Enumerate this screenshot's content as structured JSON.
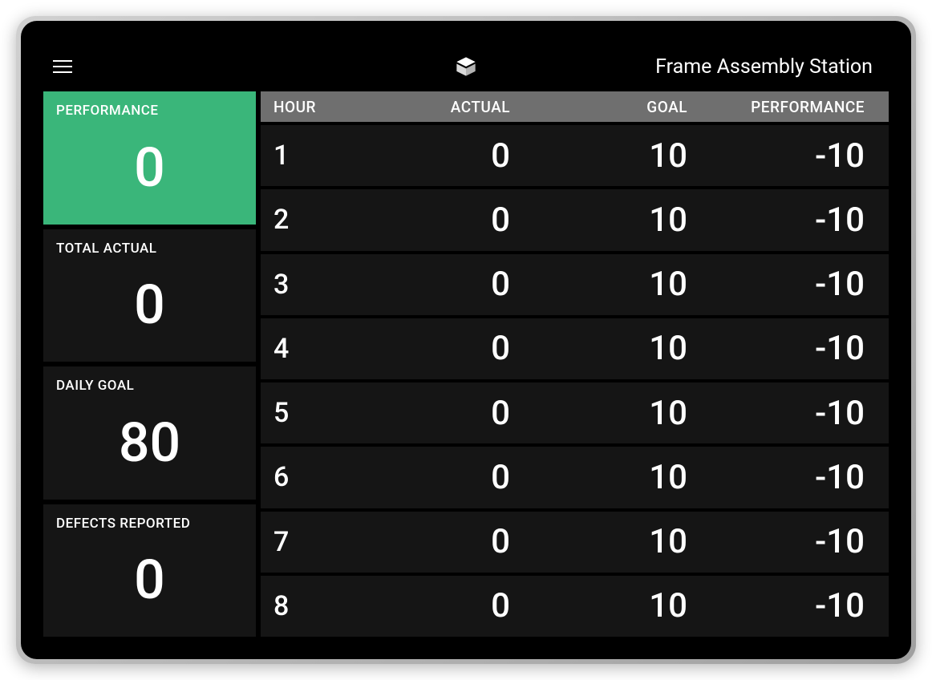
{
  "header": {
    "station_title": "Frame Assembly Station"
  },
  "sidebar": {
    "performance": {
      "label": "PERFORMANCE",
      "value": "0"
    },
    "total_actual": {
      "label": "TOTAL ACTUAL",
      "value": "0"
    },
    "daily_goal": {
      "label": "DAILY GOAL",
      "value": "80"
    },
    "defects": {
      "label": "DEFECTS REPORTED",
      "value": "0"
    }
  },
  "table": {
    "headers": {
      "hour": "HOUR",
      "actual": "ACTUAL",
      "goal": "GOAL",
      "performance": "PERFORMANCE"
    },
    "rows": [
      {
        "hour": "1",
        "actual": "0",
        "goal": "10",
        "performance": "-10"
      },
      {
        "hour": "2",
        "actual": "0",
        "goal": "10",
        "performance": "-10"
      },
      {
        "hour": "3",
        "actual": "0",
        "goal": "10",
        "performance": "-10"
      },
      {
        "hour": "4",
        "actual": "0",
        "goal": "10",
        "performance": "-10"
      },
      {
        "hour": "5",
        "actual": "0",
        "goal": "10",
        "performance": "-10"
      },
      {
        "hour": "6",
        "actual": "0",
        "goal": "10",
        "performance": "-10"
      },
      {
        "hour": "7",
        "actual": "0",
        "goal": "10",
        "performance": "-10"
      },
      {
        "hour": "8",
        "actual": "0",
        "goal": "10",
        "performance": "-10"
      }
    ]
  },
  "colors": {
    "accent_green": "#3ab67a",
    "card_bg": "#151515",
    "header_gray": "#6f6f6f"
  }
}
